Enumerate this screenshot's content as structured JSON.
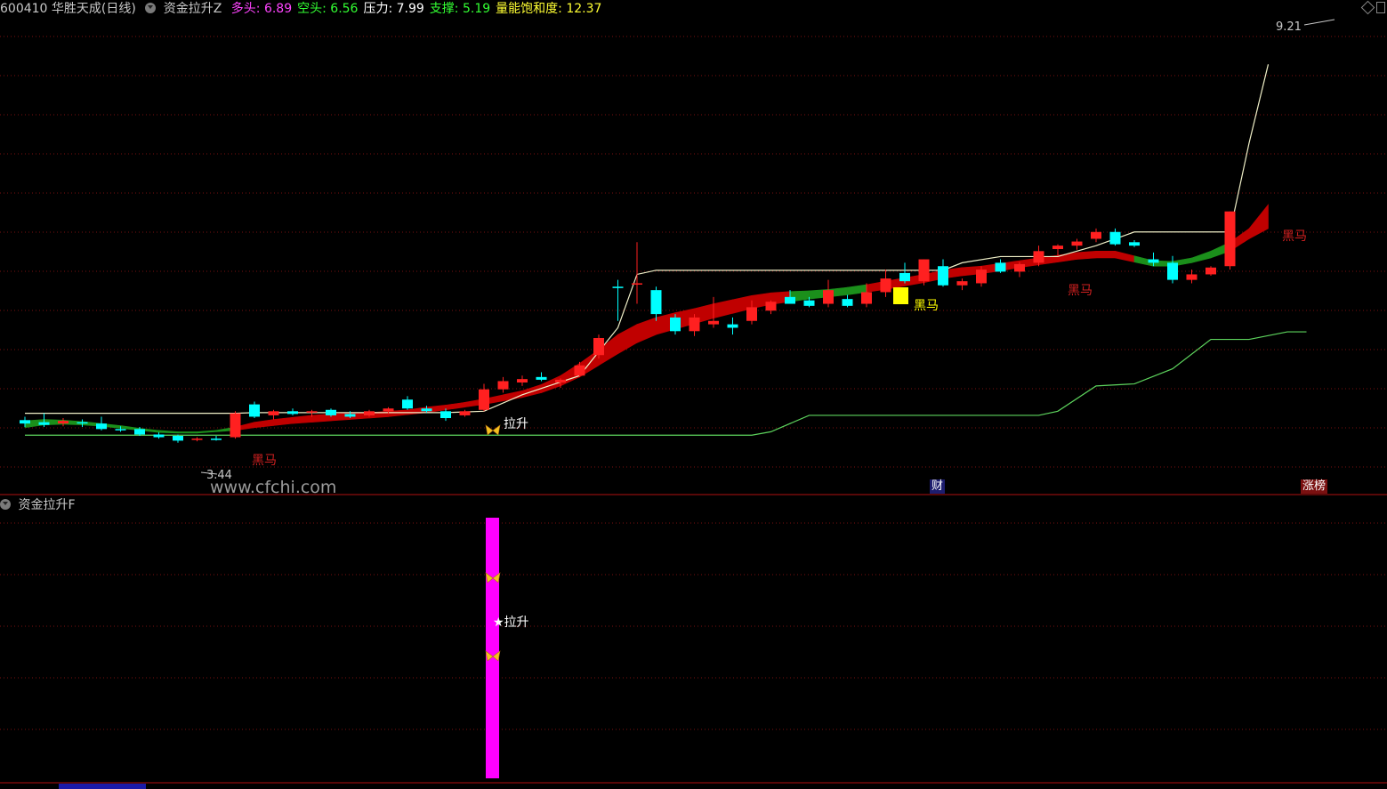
{
  "header": {
    "stock": "600410 华胜天成(日线)",
    "indicator": "资金拉升Z",
    "items": [
      {
        "label": "多头:",
        "value": "6.89",
        "color": "#ff44ff"
      },
      {
        "label": "空头:",
        "value": "6.56",
        "color": "#33ff33"
      },
      {
        "label": "压力:",
        "value": "7.99",
        "color": "#ffffff"
      },
      {
        "label": "支撑:",
        "value": "5.19",
        "color": "#33ff33"
      },
      {
        "label": "量能饱和度:",
        "value": "12.37",
        "color": "#ffff33"
      }
    ]
  },
  "sub_panel": {
    "title": "资金拉升F"
  },
  "watermark": "www.cfchi.com",
  "tags": {
    "cai": "财",
    "zhangbang": "涨榜"
  },
  "annotations": {
    "high": "9.21",
    "low": "3.44",
    "heima": "黑马",
    "lasheng": "拉升"
  },
  "colors": {
    "up": "#ff2020",
    "down": "#00ffff",
    "band_red": "#c00000",
    "band_green": "#1b8f1b",
    "pressure": "#f0f0c8",
    "support": "#5dd45d",
    "signal_bar": "#ff00ff",
    "accent_yellow": "#ffff00"
  },
  "chart_data": {
    "type": "candlestick",
    "y_range": [
      3.0,
      9.5
    ],
    "high_label": 9.21,
    "low_label": 3.44,
    "candles": [
      [
        3.75,
        3.8,
        3.65,
        3.7
      ],
      [
        3.72,
        3.85,
        3.65,
        3.68
      ],
      [
        3.7,
        3.78,
        3.66,
        3.74
      ],
      [
        3.72,
        3.76,
        3.65,
        3.7
      ],
      [
        3.7,
        3.8,
        3.6,
        3.62
      ],
      [
        3.62,
        3.66,
        3.58,
        3.6
      ],
      [
        3.62,
        3.65,
        3.52,
        3.54
      ],
      [
        3.54,
        3.57,
        3.48,
        3.5
      ],
      [
        3.52,
        3.54,
        3.42,
        3.45
      ],
      [
        3.47,
        3.5,
        3.44,
        3.48
      ],
      [
        3.48,
        3.52,
        3.45,
        3.46
      ],
      [
        3.5,
        3.88,
        3.48,
        3.85
      ],
      [
        3.98,
        4.02,
        3.78,
        3.8
      ],
      [
        3.82,
        3.9,
        3.76,
        3.88
      ],
      [
        3.88,
        3.92,
        3.82,
        3.84
      ],
      [
        3.86,
        3.9,
        3.8,
        3.88
      ],
      [
        3.9,
        3.92,
        3.8,
        3.82
      ],
      [
        3.84,
        3.88,
        3.78,
        3.8
      ],
      [
        3.82,
        3.9,
        3.8,
        3.88
      ],
      [
        3.88,
        3.94,
        3.84,
        3.92
      ],
      [
        4.05,
        4.1,
        3.9,
        3.92
      ],
      [
        3.92,
        3.96,
        3.86,
        3.88
      ],
      [
        3.88,
        3.92,
        3.74,
        3.78
      ],
      [
        3.82,
        3.9,
        3.8,
        3.88
      ],
      [
        3.9,
        4.28,
        3.88,
        4.2
      ],
      [
        4.2,
        4.38,
        4.15,
        4.32
      ],
      [
        4.3,
        4.4,
        4.25,
        4.35
      ],
      [
        4.38,
        4.45,
        4.32,
        4.34
      ],
      [
        4.3,
        4.36,
        4.22,
        4.34
      ],
      [
        4.4,
        4.6,
        4.38,
        4.55
      ],
      [
        4.7,
        5.0,
        4.65,
        4.95
      ],
      [
        5.7,
        5.8,
        5.2,
        5.68
      ],
      [
        5.75,
        6.35,
        5.45,
        5.75
      ],
      [
        5.65,
        5.7,
        5.2,
        5.3
      ],
      [
        5.25,
        5.3,
        5.0,
        5.05
      ],
      [
        5.05,
        5.3,
        4.98,
        5.25
      ],
      [
        5.15,
        5.55,
        5.1,
        5.2
      ],
      [
        5.15,
        5.25,
        5.0,
        5.1
      ],
      [
        5.2,
        5.5,
        5.15,
        5.4
      ],
      [
        5.35,
        5.5,
        5.3,
        5.48
      ],
      [
        5.55,
        5.65,
        5.45,
        5.45
      ],
      [
        5.5,
        5.55,
        5.4,
        5.42
      ],
      [
        5.45,
        5.8,
        5.4,
        5.65
      ],
      [
        5.52,
        5.58,
        5.4,
        5.42
      ],
      [
        5.45,
        5.75,
        5.4,
        5.62
      ],
      [
        5.62,
        5.95,
        5.55,
        5.82
      ],
      [
        5.9,
        6.05,
        5.75,
        5.78
      ],
      [
        5.78,
        6.1,
        5.72,
        6.1
      ],
      [
        6.0,
        6.1,
        5.7,
        5.72
      ],
      [
        5.72,
        5.82,
        5.65,
        5.78
      ],
      [
        5.75,
        6.0,
        5.7,
        5.95
      ],
      [
        6.05,
        6.1,
        5.9,
        5.92
      ],
      [
        5.92,
        6.06,
        5.84,
        6.03
      ],
      [
        6.05,
        6.3,
        6.0,
        6.22
      ],
      [
        6.25,
        6.32,
        6.15,
        6.3
      ],
      [
        6.3,
        6.4,
        6.24,
        6.36
      ],
      [
        6.4,
        6.55,
        6.35,
        6.5
      ],
      [
        6.5,
        6.55,
        6.3,
        6.32
      ],
      [
        6.35,
        6.38,
        6.28,
        6.3
      ],
      [
        6.1,
        6.2,
        6.0,
        6.05
      ],
      [
        6.05,
        6.15,
        5.75,
        5.8
      ],
      [
        5.8,
        5.95,
        5.75,
        5.88
      ],
      [
        5.88,
        6.0,
        5.86,
        5.98
      ],
      [
        6.0,
        6.8,
        5.95,
        6.8
      ]
    ],
    "pressure_line": {
      "points": [
        [
          0,
          3.85
        ],
        [
          11,
          3.85
        ],
        [
          12,
          3.86
        ],
        [
          22,
          3.86
        ],
        [
          24,
          3.88
        ],
        [
          26,
          4.12
        ],
        [
          29,
          4.4
        ],
        [
          31,
          5.1
        ],
        [
          32,
          5.88
        ],
        [
          33,
          5.94
        ],
        [
          48,
          5.94
        ],
        [
          49,
          6.05
        ],
        [
          51,
          6.14
        ],
        [
          54,
          6.14
        ],
        [
          56,
          6.3
        ],
        [
          58,
          6.5
        ],
        [
          63,
          6.5
        ],
        [
          64,
          7.8
        ],
        [
          65,
          8.95
        ]
      ]
    },
    "support_line": {
      "points": [
        [
          0,
          3.53
        ],
        [
          38,
          3.53
        ],
        [
          39,
          3.58
        ],
        [
          41,
          3.82
        ],
        [
          53,
          3.82
        ],
        [
          54,
          3.88
        ],
        [
          56,
          4.25
        ],
        [
          58,
          4.28
        ],
        [
          60,
          4.5
        ],
        [
          62,
          4.93
        ],
        [
          64,
          4.93
        ],
        [
          66,
          5.04
        ],
        [
          67,
          5.04
        ]
      ]
    },
    "band_upper": [
      3.74,
      3.76,
      3.75,
      3.73,
      3.7,
      3.67,
      3.63,
      3.6,
      3.58,
      3.58,
      3.6,
      3.65,
      3.72,
      3.76,
      3.79,
      3.82,
      3.84,
      3.85,
      3.86,
      3.88,
      3.9,
      3.94,
      3.97,
      4.01,
      4.06,
      4.12,
      4.18,
      4.27,
      4.4,
      4.58,
      4.78,
      5.0,
      5.15,
      5.25,
      5.32,
      5.38,
      5.45,
      5.51,
      5.57,
      5.61,
      5.63,
      5.64,
      5.66,
      5.69,
      5.73,
      5.78,
      5.83,
      5.88,
      5.94,
      5.98,
      6.0,
      6.04,
      6.08,
      6.12,
      6.16,
      6.2,
      6.22,
      6.22,
      6.15,
      6.08,
      6.07,
      6.12,
      6.22,
      6.35,
      6.55,
      6.9
    ],
    "band_lower": [
      3.64,
      3.68,
      3.69,
      3.68,
      3.66,
      3.63,
      3.6,
      3.57,
      3.56,
      3.56,
      3.58,
      3.6,
      3.64,
      3.67,
      3.7,
      3.72,
      3.74,
      3.76,
      3.78,
      3.8,
      3.83,
      3.86,
      3.9,
      3.94,
      3.98,
      4.03,
      4.08,
      4.15,
      4.25,
      4.38,
      4.55,
      4.72,
      4.88,
      5.0,
      5.08,
      5.16,
      5.24,
      5.31,
      5.38,
      5.44,
      5.48,
      5.52,
      5.55,
      5.58,
      5.62,
      5.66,
      5.71,
      5.76,
      5.82,
      5.86,
      5.89,
      5.93,
      5.98,
      6.02,
      6.06,
      6.1,
      6.12,
      6.12,
      6.06,
      6.0,
      6.0,
      6.05,
      6.12,
      6.22,
      6.4,
      6.55
    ],
    "band_green_ranges": [
      [
        0,
        11
      ],
      [
        40,
        44
      ],
      [
        58,
        63
      ]
    ],
    "signal": {
      "index": 25,
      "ymax": 1.0
    }
  }
}
